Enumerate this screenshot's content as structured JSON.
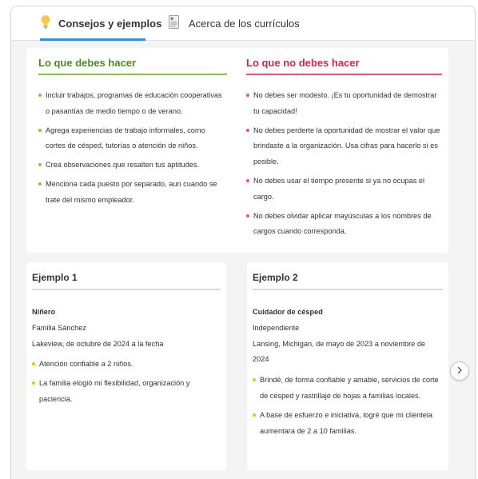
{
  "tabs": [
    {
      "label": "Consejos y ejemplos",
      "icon": "lightbulb-icon",
      "active": true
    },
    {
      "label": "Acerca de los currículos",
      "icon": "resume-document-icon",
      "active": false
    }
  ],
  "tips": {
    "do": {
      "title": "Lo que debes hacer",
      "items": [
        "Incluir trabajos, programas de educación cooperativas o pasantías de medio tiempo o de verano.",
        "Agrega experiencias de trabajo informales, como cortes de césped, tutorías o atención de niños.",
        "Crea observaciones que resalten tus aptitudes.",
        "Menciona cada puesto por separado, aun cuando se trate del mismo empleador."
      ]
    },
    "dont": {
      "title": "Lo que no debes hacer",
      "items": [
        "No debes ser modesto. ¡Es tu oportunidad de demostrar tu capacidad!",
        "No debes perderte la oportunidad de mostrar el valor que brindaste a la organización. Usa cifras para hacerlo si es posible.",
        "No debes usar el tiempo presente si ya no ocupas el cargo.",
        "No debes olvidar aplicar mayúsculas a los nombres de cargos cuando corresponda."
      ]
    }
  },
  "examples": [
    {
      "title": "Ejemplo 1",
      "job": "Niñero",
      "employer": "Familia Sánchez",
      "location_dates": "Lakeview, de octubre de 2024 a la fecha",
      "bullets": [
        "Atención confiable a 2 niños.",
        "La familia elogió mi flexibilidad, organización y paciencia."
      ]
    },
    {
      "title": "Ejemplo 2",
      "job": "Cuidador de césped",
      "employer": "Independiente",
      "location_dates": "Lansing, Michigan, de mayo de 2023 a noviembre de 2024",
      "bullets": [
        "Brindé, de forma confiable y amable, servicios de corte de césped y rastrillaje de hojas a familias locales.",
        "A base de esfuerzo e iniciativa, logré que mi clientela aumentara de 2 a 10 familias."
      ]
    }
  ],
  "carousel": {
    "next_icon": "chevron-right-icon"
  },
  "colors": {
    "do_accent": "#8cc63f",
    "dont_accent": "#e8557d",
    "example_bullet": "#f2c200",
    "active_tab_underline": "#3a8fd8"
  }
}
